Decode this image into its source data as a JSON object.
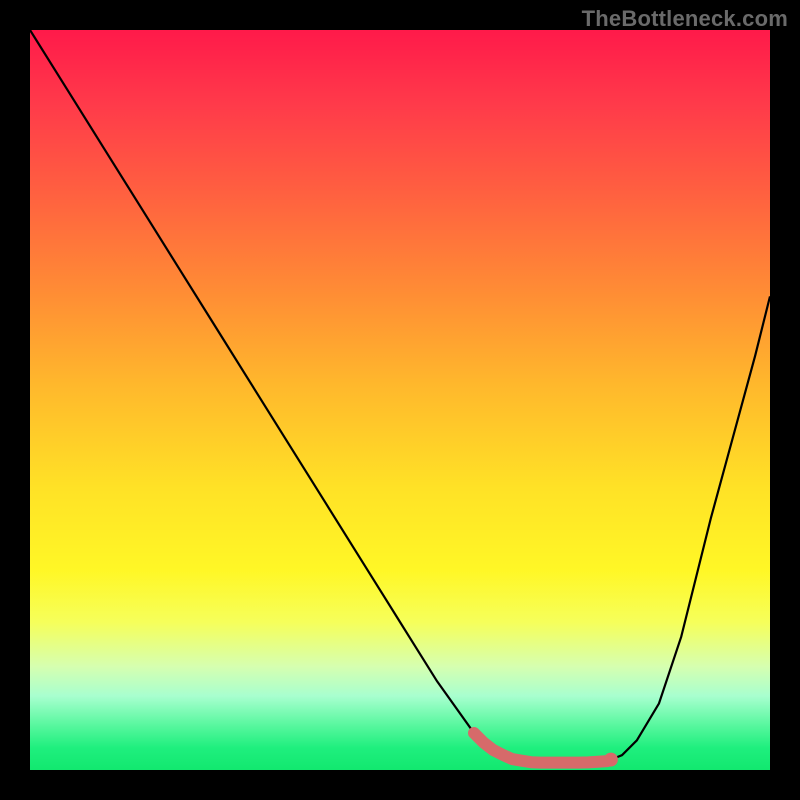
{
  "watermark": "TheBottleneck.com",
  "chart_data": {
    "type": "line",
    "title": "",
    "xlabel": "",
    "ylabel": "",
    "xlim": [
      0,
      100
    ],
    "ylim": [
      0,
      100
    ],
    "x": [
      0,
      5,
      10,
      15,
      20,
      25,
      30,
      35,
      40,
      45,
      50,
      55,
      60,
      62,
      65,
      68,
      70,
      72,
      75,
      78,
      80,
      82,
      85,
      88,
      90,
      92,
      95,
      98,
      100
    ],
    "y_curve": [
      100,
      92,
      84,
      76,
      68,
      60,
      52,
      44,
      36,
      28,
      20,
      12,
      5,
      3,
      1.5,
      1,
      1,
      1,
      1,
      1.2,
      2,
      4,
      9,
      18,
      26,
      34,
      45,
      56,
      64
    ],
    "optimal_range_x": [
      60,
      78
    ],
    "optimal_dot_x": 78.5,
    "gradient_meaning": "top=red=100% bottleneck, bottom=green=0% bottleneck",
    "grid": false,
    "legend": null
  },
  "colors": {
    "curve": "#000000",
    "optimal": "#d66a6a",
    "frame": "#000000"
  }
}
